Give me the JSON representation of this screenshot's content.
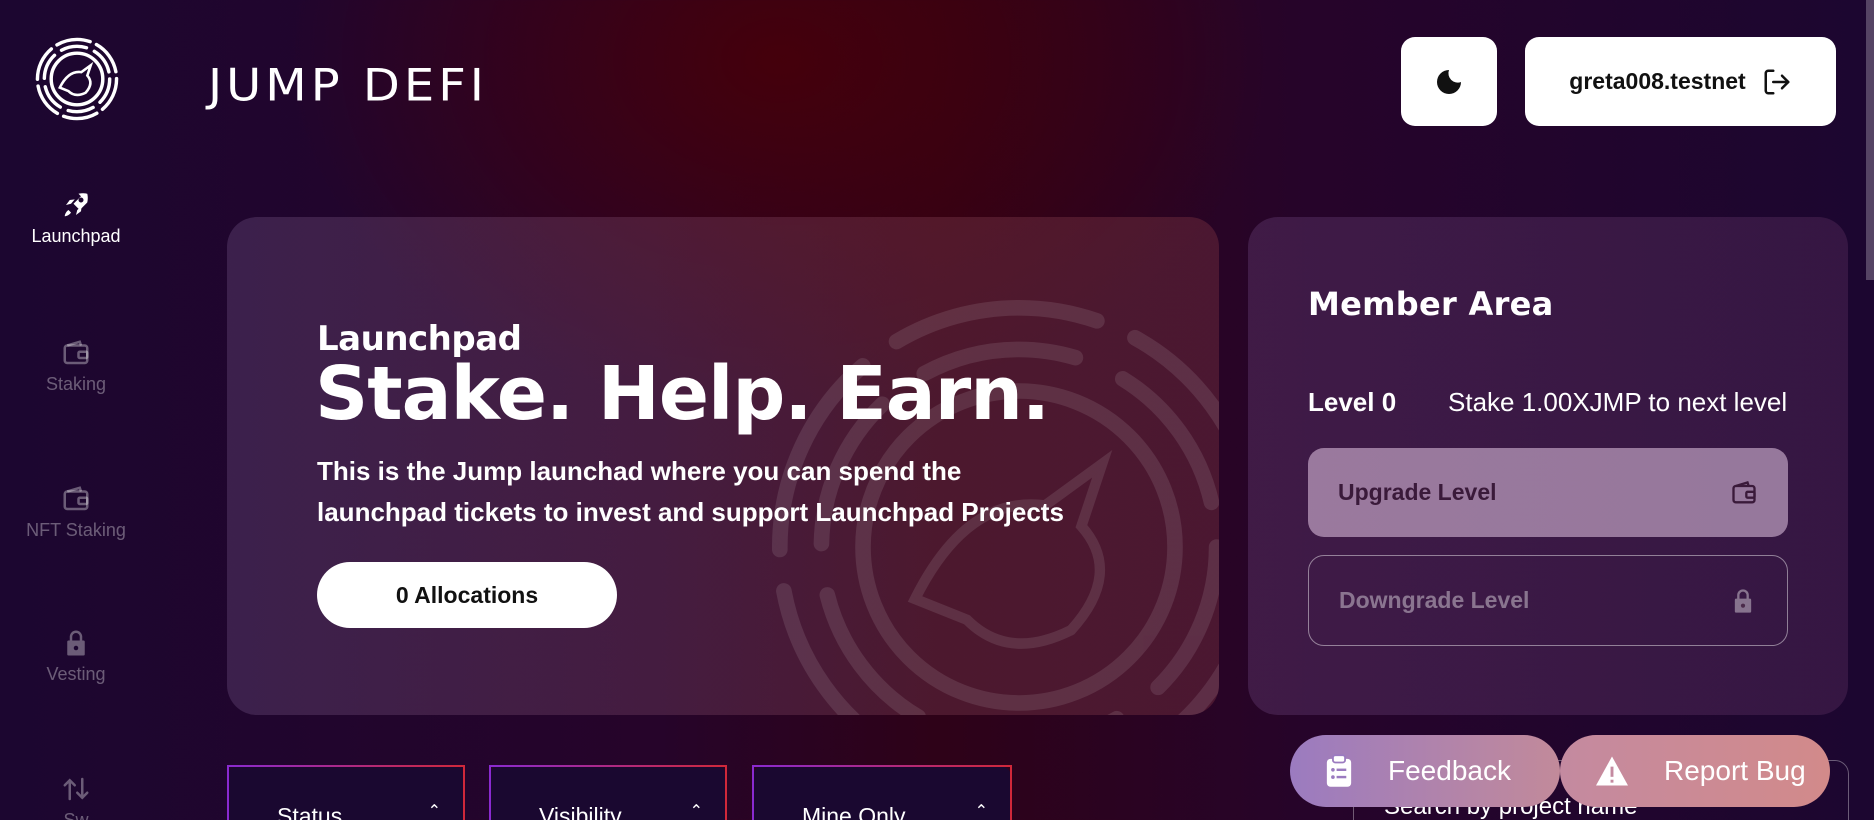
{
  "header": {
    "brand": "JUMP DEFI",
    "account": "greta008.testnet"
  },
  "nav": {
    "items": [
      {
        "label": "Launchpad",
        "icon": "rocket-icon",
        "active": true
      },
      {
        "label": "Staking",
        "icon": "wallet-icon",
        "active": false
      },
      {
        "label": "NFT Staking",
        "icon": "wallet-icon",
        "active": false
      },
      {
        "label": "Vesting",
        "icon": "lock-icon",
        "active": false
      },
      {
        "label": "Sw",
        "icon": "swap-icon",
        "active": false
      }
    ]
  },
  "hero": {
    "eyebrow": "Launchpad",
    "title": "Stake. Help. Earn.",
    "description": "This is the Jump launchad where you can spend the launchpad tickets to invest and support Launchpad Projects",
    "allocations_label": "0 Allocations"
  },
  "member": {
    "title": "Member Area",
    "level": "Level 0",
    "hint": "Stake 1.00XJMP to next level",
    "upgrade_label": "Upgrade Level",
    "downgrade_label": "Downgrade Level"
  },
  "filters": {
    "status": "Status",
    "visibility": "Visibility",
    "mine_only": "Mine Only"
  },
  "search": {
    "placeholder": "Search by project name"
  },
  "floating": {
    "feedback": "Feedback",
    "report_bug": "Report Bug"
  },
  "colors": {
    "background": "#1c0630",
    "accent_purple": "#8a2ad0",
    "accent_red": "#d0283a"
  }
}
